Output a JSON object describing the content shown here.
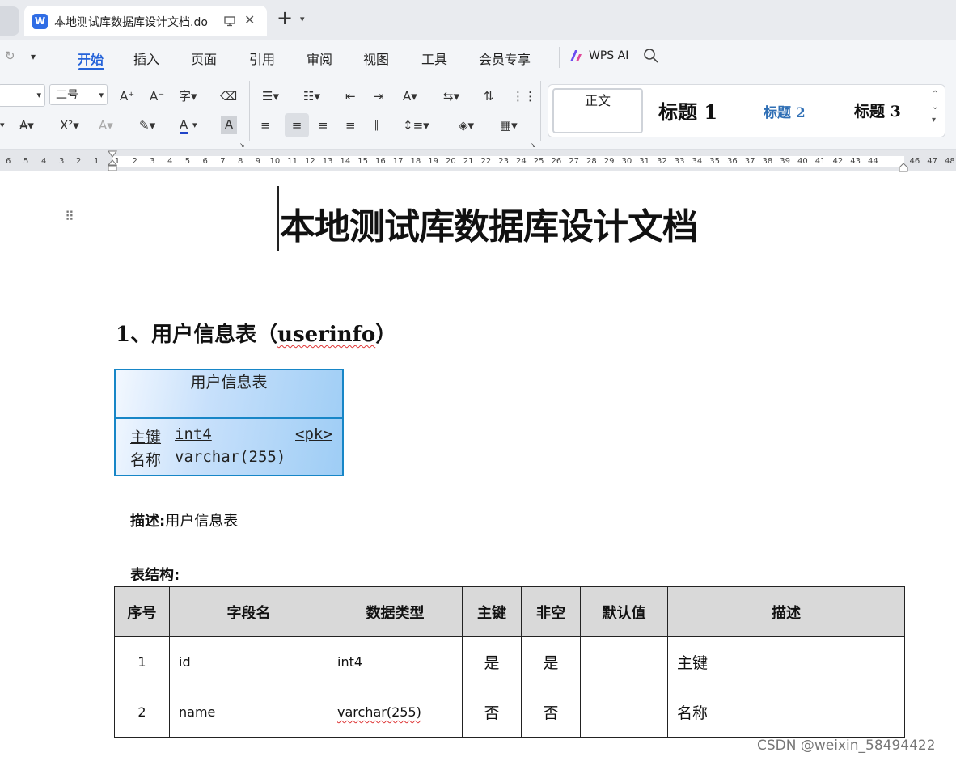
{
  "tabbar": {
    "tab_title": "本地测试库数据库设计文档.do",
    "new_tab": "+"
  },
  "menu": {
    "items": [
      "开始",
      "插入",
      "页面",
      "引用",
      "审阅",
      "视图",
      "工具",
      "会员专享"
    ],
    "wps_ai": "WPS AI"
  },
  "toolbar": {
    "font_size": "二号",
    "styles": {
      "normal": "正文",
      "h1": "标题 1",
      "h2": "标题 2",
      "h3": "标题 3"
    }
  },
  "ruler": {
    "left_numbers": [
      "6",
      "5",
      "4",
      "3",
      "2",
      "1"
    ],
    "right_numbers": [
      "1",
      "2",
      "3",
      "4",
      "5",
      "6",
      "7",
      "8",
      "9",
      "10",
      "11",
      "12",
      "13",
      "14",
      "15",
      "16",
      "17",
      "18",
      "19",
      "20",
      "21",
      "22",
      "23",
      "24",
      "25",
      "26",
      "27",
      "28",
      "29",
      "30",
      "31",
      "32",
      "33",
      "34",
      "35",
      "36",
      "37",
      "38",
      "39",
      "40",
      "41",
      "42",
      "43",
      "44",
      "46",
      "47",
      "48"
    ]
  },
  "document": {
    "title": "本地测试库数据库设计文档",
    "section1": {
      "prefix": "1、用户信息表（",
      "name": "userinfo",
      "suffix": "）"
    },
    "entity": {
      "title": "用户信息表",
      "rows": [
        {
          "label": "主键",
          "type": "int4",
          "key": "<pk>"
        },
        {
          "label": "名称",
          "type": "varchar(255)",
          "key": ""
        }
      ]
    },
    "description": {
      "label": "描述:",
      "value": "用户信息表"
    },
    "structure_label": "表结构:",
    "table": {
      "headers": [
        "序号",
        "字段名",
        "数据类型",
        "主键",
        "非空",
        "默认值",
        "描述"
      ],
      "rows": [
        [
          "1",
          "id",
          "int4",
          "是",
          "是",
          "",
          "主键"
        ],
        [
          "2",
          "name",
          "varchar(255)",
          "否",
          "否",
          "",
          "名称"
        ]
      ]
    }
  },
  "watermark": "CSDN @weixin_58494422",
  "colors": {
    "accent": "#2563d9",
    "entity_border": "#1786c7",
    "header_bg": "#d9d9d9"
  }
}
